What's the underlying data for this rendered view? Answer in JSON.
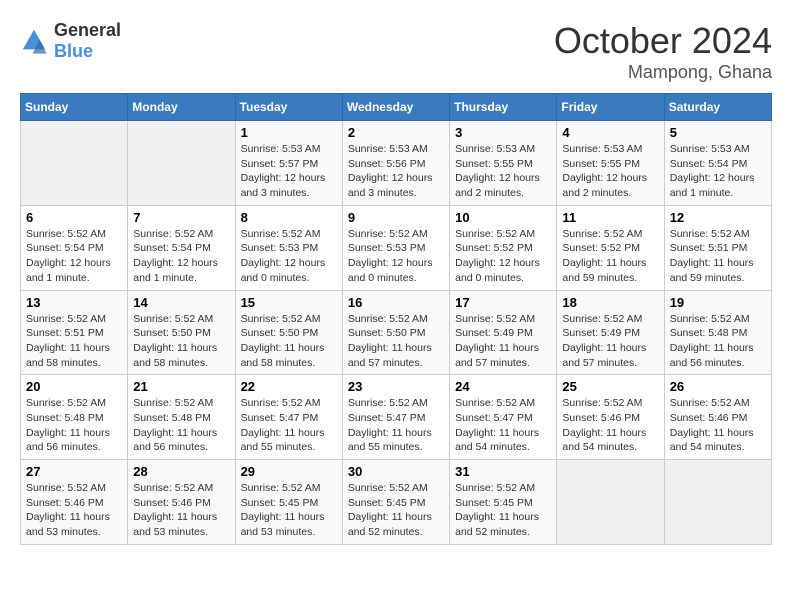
{
  "logo": {
    "general": "General",
    "blue": "Blue"
  },
  "header": {
    "month": "October 2024",
    "location": "Mampong, Ghana"
  },
  "days_of_week": [
    "Sunday",
    "Monday",
    "Tuesday",
    "Wednesday",
    "Thursday",
    "Friday",
    "Saturday"
  ],
  "weeks": [
    [
      {
        "day": "",
        "empty": true
      },
      {
        "day": "",
        "empty": true
      },
      {
        "day": "1",
        "info": "Sunrise: 5:53 AM\nSunset: 5:57 PM\nDaylight: 12 hours and 3 minutes."
      },
      {
        "day": "2",
        "info": "Sunrise: 5:53 AM\nSunset: 5:56 PM\nDaylight: 12 hours and 3 minutes."
      },
      {
        "day": "3",
        "info": "Sunrise: 5:53 AM\nSunset: 5:55 PM\nDaylight: 12 hours and 2 minutes."
      },
      {
        "day": "4",
        "info": "Sunrise: 5:53 AM\nSunset: 5:55 PM\nDaylight: 12 hours and 2 minutes."
      },
      {
        "day": "5",
        "info": "Sunrise: 5:53 AM\nSunset: 5:54 PM\nDaylight: 12 hours and 1 minute."
      }
    ],
    [
      {
        "day": "6",
        "info": "Sunrise: 5:52 AM\nSunset: 5:54 PM\nDaylight: 12 hours and 1 minute."
      },
      {
        "day": "7",
        "info": "Sunrise: 5:52 AM\nSunset: 5:54 PM\nDaylight: 12 hours and 1 minute."
      },
      {
        "day": "8",
        "info": "Sunrise: 5:52 AM\nSunset: 5:53 PM\nDaylight: 12 hours and 0 minutes."
      },
      {
        "day": "9",
        "info": "Sunrise: 5:52 AM\nSunset: 5:53 PM\nDaylight: 12 hours and 0 minutes."
      },
      {
        "day": "10",
        "info": "Sunrise: 5:52 AM\nSunset: 5:52 PM\nDaylight: 12 hours and 0 minutes."
      },
      {
        "day": "11",
        "info": "Sunrise: 5:52 AM\nSunset: 5:52 PM\nDaylight: 11 hours and 59 minutes."
      },
      {
        "day": "12",
        "info": "Sunrise: 5:52 AM\nSunset: 5:51 PM\nDaylight: 11 hours and 59 minutes."
      }
    ],
    [
      {
        "day": "13",
        "info": "Sunrise: 5:52 AM\nSunset: 5:51 PM\nDaylight: 11 hours and 58 minutes."
      },
      {
        "day": "14",
        "info": "Sunrise: 5:52 AM\nSunset: 5:50 PM\nDaylight: 11 hours and 58 minutes."
      },
      {
        "day": "15",
        "info": "Sunrise: 5:52 AM\nSunset: 5:50 PM\nDaylight: 11 hours and 58 minutes."
      },
      {
        "day": "16",
        "info": "Sunrise: 5:52 AM\nSunset: 5:50 PM\nDaylight: 11 hours and 57 minutes."
      },
      {
        "day": "17",
        "info": "Sunrise: 5:52 AM\nSunset: 5:49 PM\nDaylight: 11 hours and 57 minutes."
      },
      {
        "day": "18",
        "info": "Sunrise: 5:52 AM\nSunset: 5:49 PM\nDaylight: 11 hours and 57 minutes."
      },
      {
        "day": "19",
        "info": "Sunrise: 5:52 AM\nSunset: 5:48 PM\nDaylight: 11 hours and 56 minutes."
      }
    ],
    [
      {
        "day": "20",
        "info": "Sunrise: 5:52 AM\nSunset: 5:48 PM\nDaylight: 11 hours and 56 minutes."
      },
      {
        "day": "21",
        "info": "Sunrise: 5:52 AM\nSunset: 5:48 PM\nDaylight: 11 hours and 56 minutes."
      },
      {
        "day": "22",
        "info": "Sunrise: 5:52 AM\nSunset: 5:47 PM\nDaylight: 11 hours and 55 minutes."
      },
      {
        "day": "23",
        "info": "Sunrise: 5:52 AM\nSunset: 5:47 PM\nDaylight: 11 hours and 55 minutes."
      },
      {
        "day": "24",
        "info": "Sunrise: 5:52 AM\nSunset: 5:47 PM\nDaylight: 11 hours and 54 minutes."
      },
      {
        "day": "25",
        "info": "Sunrise: 5:52 AM\nSunset: 5:46 PM\nDaylight: 11 hours and 54 minutes."
      },
      {
        "day": "26",
        "info": "Sunrise: 5:52 AM\nSunset: 5:46 PM\nDaylight: 11 hours and 54 minutes."
      }
    ],
    [
      {
        "day": "27",
        "info": "Sunrise: 5:52 AM\nSunset: 5:46 PM\nDaylight: 11 hours and 53 minutes."
      },
      {
        "day": "28",
        "info": "Sunrise: 5:52 AM\nSunset: 5:46 PM\nDaylight: 11 hours and 53 minutes."
      },
      {
        "day": "29",
        "info": "Sunrise: 5:52 AM\nSunset: 5:45 PM\nDaylight: 11 hours and 53 minutes."
      },
      {
        "day": "30",
        "info": "Sunrise: 5:52 AM\nSunset: 5:45 PM\nDaylight: 11 hours and 52 minutes."
      },
      {
        "day": "31",
        "info": "Sunrise: 5:52 AM\nSunset: 5:45 PM\nDaylight: 11 hours and 52 minutes."
      },
      {
        "day": "",
        "empty": true
      },
      {
        "day": "",
        "empty": true
      }
    ]
  ]
}
